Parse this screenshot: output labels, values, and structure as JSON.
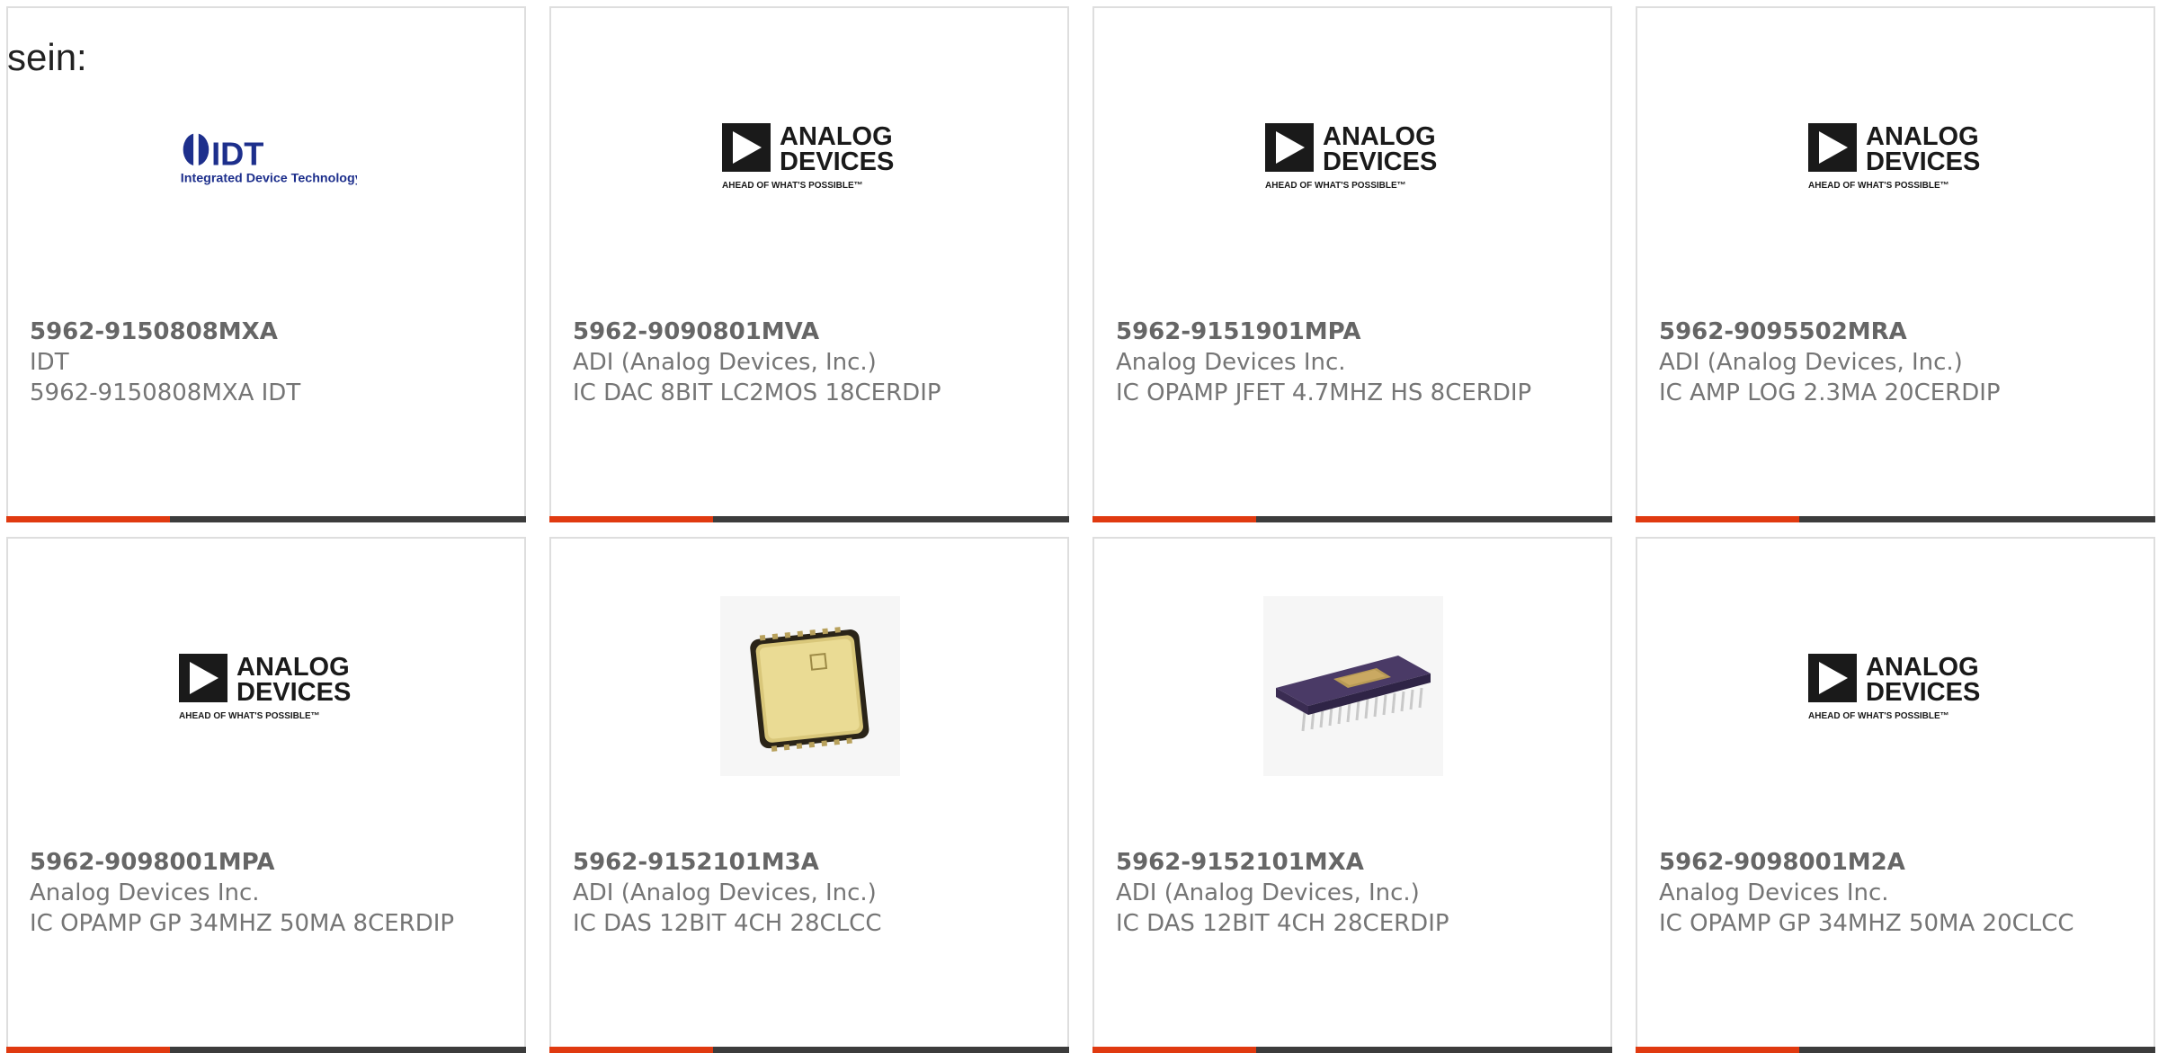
{
  "intro_text": "sein:",
  "products": [
    {
      "part": "5962-9150808MXA",
      "maker": "IDT",
      "desc": "5962-9150808MXA IDT",
      "image": "idt-logo",
      "logo": {
        "name": "IDT",
        "sub": "Integrated Device Technology"
      }
    },
    {
      "part": "5962-9090801MVA",
      "maker": "ADI (Analog Devices, Inc.)",
      "desc": "IC DAC 8BIT LC2MOS 18CERDIP",
      "image": "analog-devices-logo",
      "logo": {
        "line1": "ANALOG",
        "line2": "DEVICES",
        "tagline": "AHEAD OF WHAT'S POSSIBLE™"
      }
    },
    {
      "part": "5962-9151901MPA",
      "maker": "Analog Devices Inc.",
      "desc": "IC OPAMP JFET 4.7MHZ HS 8CERDIP",
      "image": "analog-devices-logo",
      "logo": {
        "line1": "ANALOG",
        "line2": "DEVICES",
        "tagline": "AHEAD OF WHAT'S POSSIBLE™"
      }
    },
    {
      "part": "5962-9095502MRA",
      "maker": "ADI (Analog Devices, Inc.)",
      "desc": "IC AMP LOG 2.3MA 20CERDIP",
      "image": "analog-devices-logo",
      "logo": {
        "line1": "ANALOG",
        "line2": "DEVICES",
        "tagline": "AHEAD OF WHAT'S POSSIBLE™"
      }
    },
    {
      "part": "5962-9098001MPA",
      "maker": "Analog Devices Inc.",
      "desc": "IC OPAMP GP 34MHZ 50MA 8CERDIP",
      "image": "analog-devices-logo",
      "logo": {
        "line1": "ANALOG",
        "line2": "DEVICES",
        "tagline": "AHEAD OF WHAT'S POSSIBLE™"
      }
    },
    {
      "part": "5962-9152101M3A",
      "maker": "ADI (Analog Devices, Inc.)",
      "desc": "IC DAS 12BIT 4CH 28CLCC",
      "image": "clcc-chip-photo"
    },
    {
      "part": "5962-9152101MXA",
      "maker": "ADI (Analog Devices, Inc.)",
      "desc": "IC DAS 12BIT 4CH 28CERDIP",
      "image": "cerdip-chip-photo"
    },
    {
      "part": "5962-9098001M2A",
      "maker": "Analog Devices Inc.",
      "desc": "IC OPAMP GP 34MHZ 50MA 20CLCC",
      "image": "analog-devices-logo",
      "logo": {
        "line1": "ANALOG",
        "line2": "DEVICES",
        "tagline": "AHEAD OF WHAT'S POSSIBLE™"
      }
    }
  ],
  "colors": {
    "accent": "#e03a10",
    "bar": "#3c3c3c",
    "border": "#dedede",
    "text": "#757575",
    "idt_blue": "#1d2f8c"
  }
}
